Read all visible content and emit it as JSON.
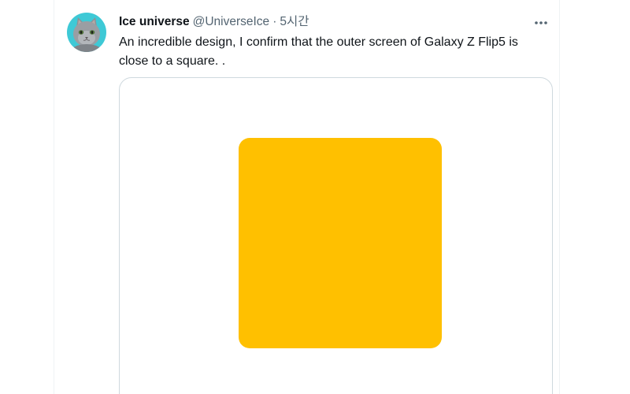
{
  "tweet": {
    "author": {
      "display_name": "Ice universe",
      "handle": "@UniverseIce",
      "avatar_icon": "gray-cat-avatar"
    },
    "separator": "·",
    "timestamp": "5시간",
    "more_icon": "more-dots-icon",
    "text": "An incredible design, I confirm that the outer screen of Galaxy Z Flip5 is\nclose to a square. .",
    "media": {
      "shape_color": "#ffc000",
      "description_icon": "yellow-square-image"
    }
  },
  "colors": {
    "text_primary": "#0f1419",
    "text_secondary": "#536471",
    "card_border": "#cfd9de",
    "avatar_background": "#3ec9d6",
    "accent_yellow": "#ffc000"
  }
}
